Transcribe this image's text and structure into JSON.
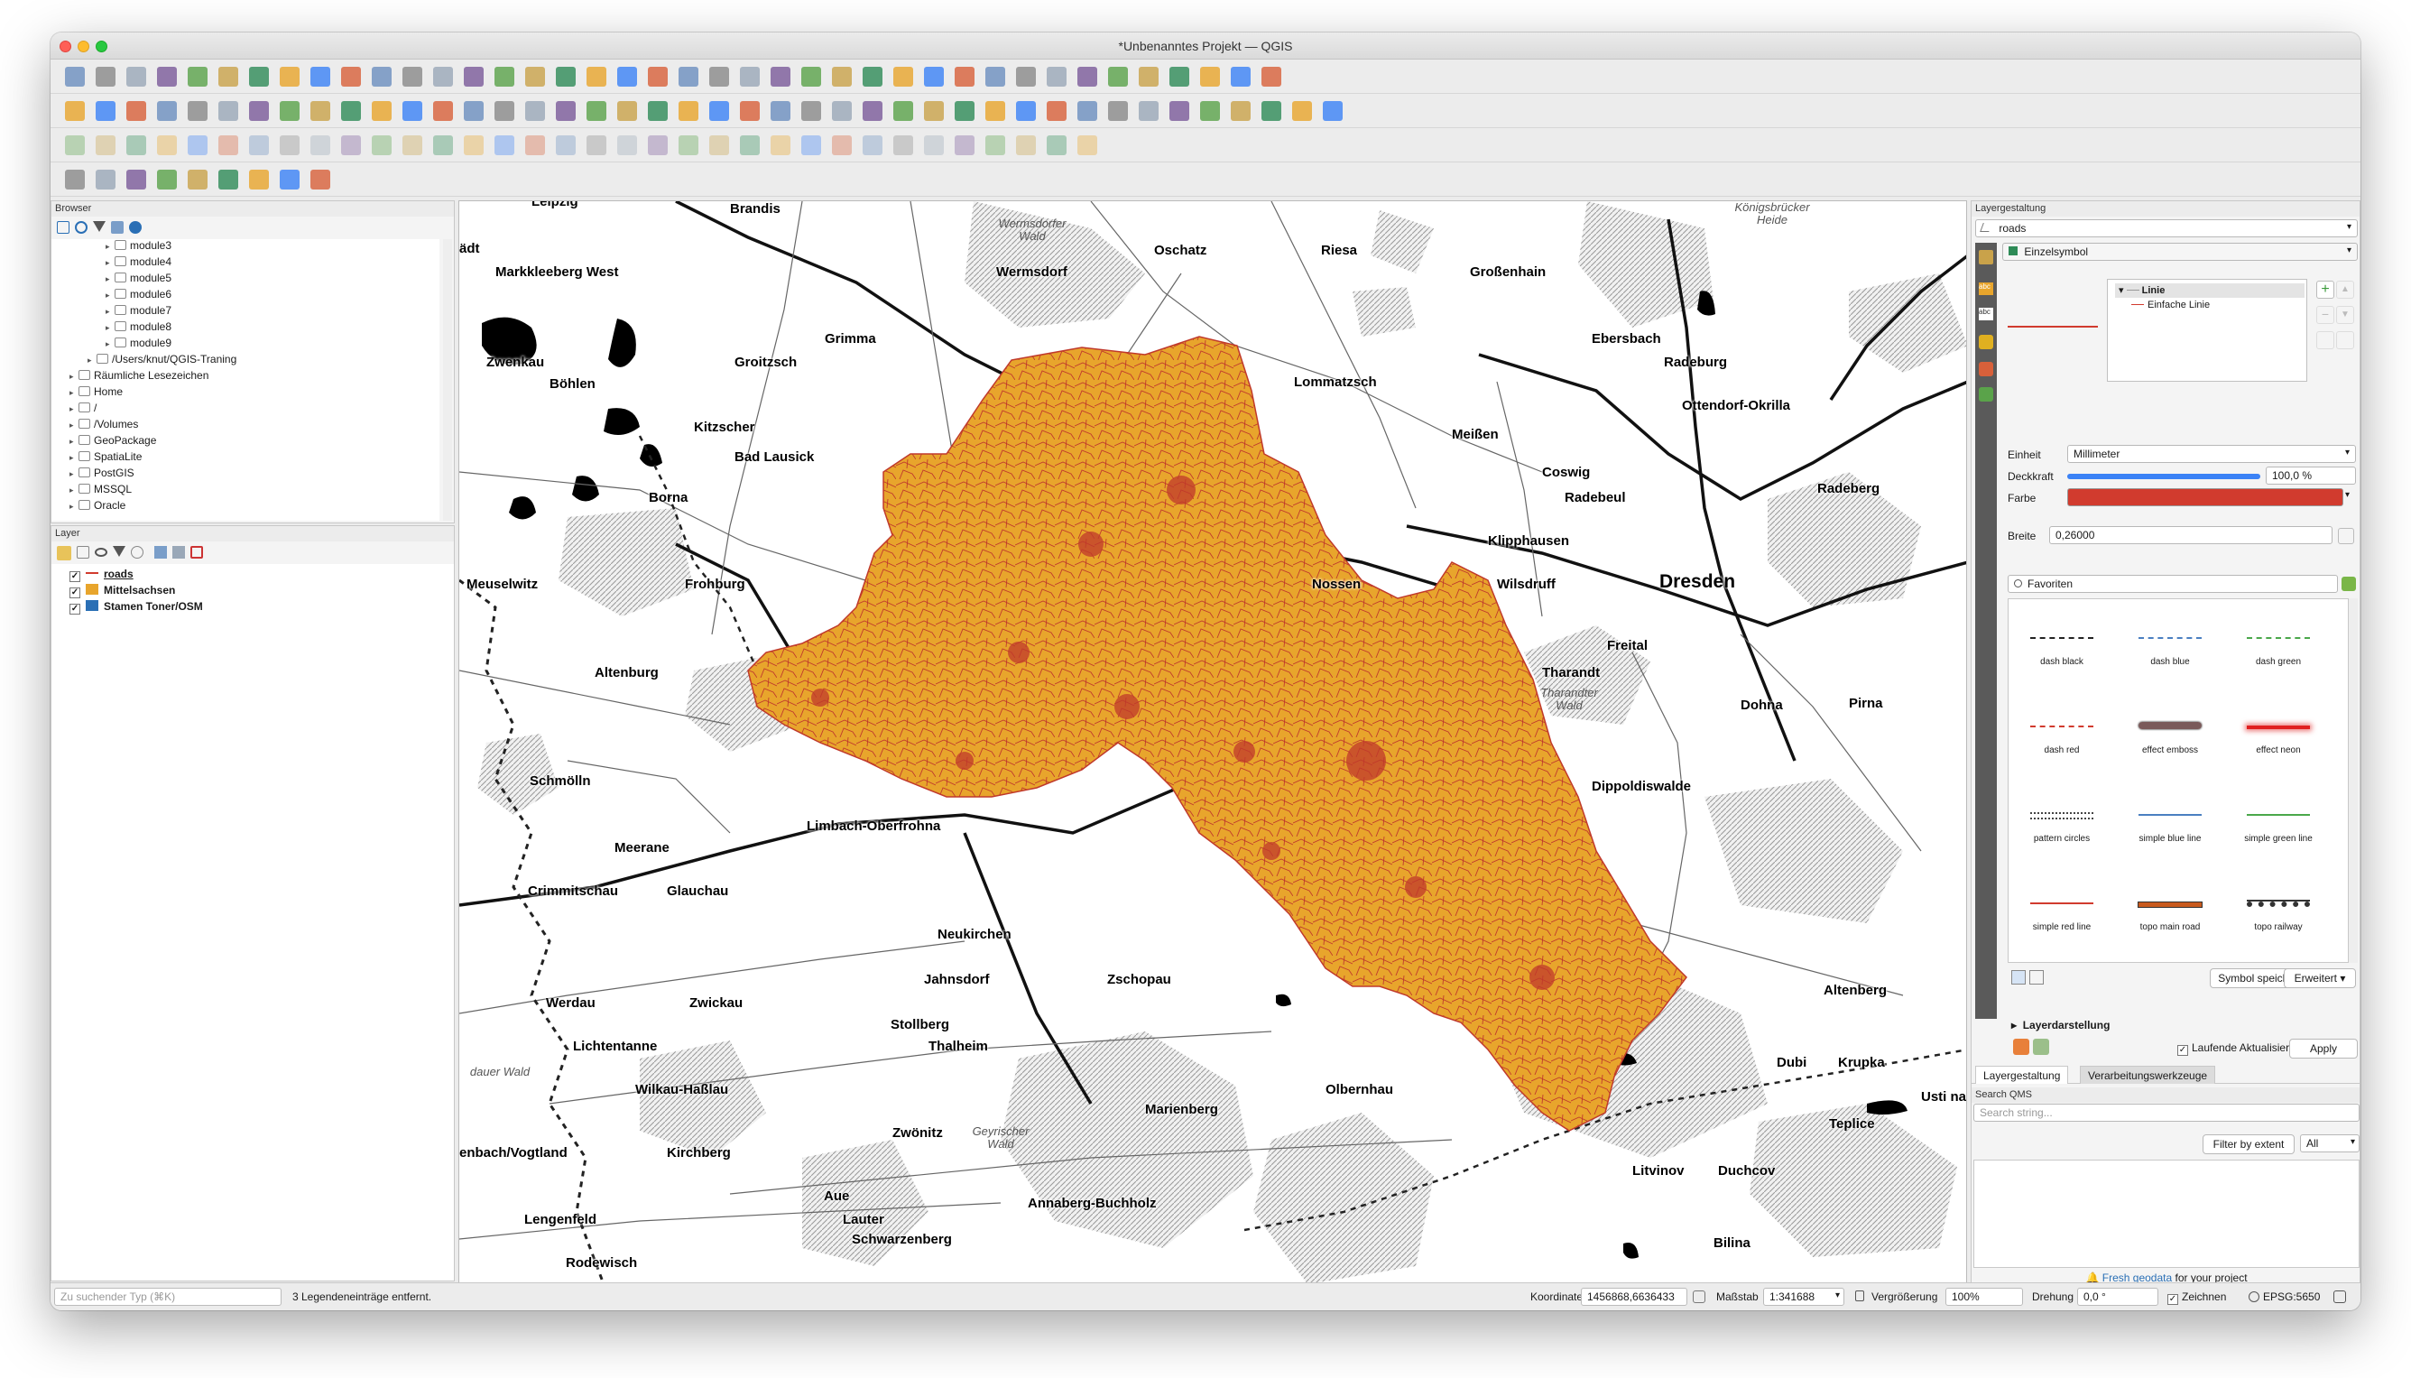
{
  "window": {
    "title": "*Unbenanntes Projekt — QGIS"
  },
  "browser": {
    "title": "Browser",
    "items": [
      {
        "label": "module3",
        "depth": 2
      },
      {
        "label": "module4",
        "depth": 2
      },
      {
        "label": "module5",
        "depth": 2
      },
      {
        "label": "module6",
        "depth": 2
      },
      {
        "label": "module7",
        "depth": 2
      },
      {
        "label": "module8",
        "depth": 2
      },
      {
        "label": "module9",
        "depth": 2
      },
      {
        "label": "/Users/knut/QGIS-Traning",
        "depth": 1
      },
      {
        "label": "Räumliche Lesezeichen",
        "depth": 0
      },
      {
        "label": "Home",
        "depth": 0
      },
      {
        "label": "/",
        "depth": 0
      },
      {
        "label": "/Volumes",
        "depth": 0
      },
      {
        "label": "GeoPackage",
        "depth": 0
      },
      {
        "label": "SpatiaLite",
        "depth": 0
      },
      {
        "label": "PostGIS",
        "depth": 0
      },
      {
        "label": "MSSQL",
        "depth": 0
      },
      {
        "label": "Oracle",
        "depth": 0
      }
    ]
  },
  "layers": {
    "title": "Layer",
    "items": [
      {
        "label": "roads",
        "checked": true,
        "swatch": "#d13b2e"
      },
      {
        "label": "Mittelsachsen",
        "checked": true,
        "swatch": "#e8a52c"
      },
      {
        "label": "Stamen Toner/OSM",
        "checked": true,
        "swatch": "#2a6fb5"
      }
    ]
  },
  "map": {
    "cities": [
      {
        "name": "Brandis"
      },
      {
        "name": "Oschatz"
      },
      {
        "name": "Riesa"
      },
      {
        "name": "Wermsdorf"
      },
      {
        "name": "Markkleeberg West"
      },
      {
        "name": "Großenhain"
      },
      {
        "name": "Grimma"
      },
      {
        "name": "Ebersbach"
      },
      {
        "name": "Zwenkau"
      },
      {
        "name": "Groitzsch"
      },
      {
        "name": "Radeburg"
      },
      {
        "name": "Lommatzsch"
      },
      {
        "name": "Böhlen"
      },
      {
        "name": "Ottendorf-Okrilla"
      },
      {
        "name": "Kitzscher"
      },
      {
        "name": "Meißen"
      },
      {
        "name": "Bad Lausick"
      },
      {
        "name": "Coswig"
      },
      {
        "name": "Borna"
      },
      {
        "name": "Radebeul"
      },
      {
        "name": "Radeberg"
      },
      {
        "name": "Klipphausen"
      },
      {
        "name": "Meuselwitz"
      },
      {
        "name": "Frohburg"
      },
      {
        "name": "Nossen"
      },
      {
        "name": "Wilsdruff"
      },
      {
        "name": "Dresden"
      },
      {
        "name": "Altenburg"
      },
      {
        "name": "Freital"
      },
      {
        "name": "Tharandt"
      },
      {
        "name": "Dohna"
      },
      {
        "name": "Pirna"
      },
      {
        "name": "Schmölln"
      },
      {
        "name": "Dippoldiswalde"
      },
      {
        "name": "Limbach-Oberfrohna"
      },
      {
        "name": "Meerane"
      },
      {
        "name": "Crimmitschau"
      },
      {
        "name": "Glauchau"
      },
      {
        "name": "Neukirchen"
      },
      {
        "name": "Jahnsdorf"
      },
      {
        "name": "Zschopau"
      },
      {
        "name": "Altenberg"
      },
      {
        "name": "Werdau"
      },
      {
        "name": "Zwickau"
      },
      {
        "name": "Stollberg"
      },
      {
        "name": "Lichtentanne"
      },
      {
        "name": "Thalheim"
      },
      {
        "name": "Dubi"
      },
      {
        "name": "Krupka"
      },
      {
        "name": "Wilkau-Haßlau"
      },
      {
        "name": "Olbernhau"
      },
      {
        "name": "Usti nad"
      },
      {
        "name": "Marienberg"
      },
      {
        "name": "Teplice"
      },
      {
        "name": "enbach/Vogtland"
      },
      {
        "name": "Kirchberg"
      },
      {
        "name": "Zwönitz"
      },
      {
        "name": "Litvinov"
      },
      {
        "name": "Duchcov"
      },
      {
        "name": "Aue"
      },
      {
        "name": "Annaberg-Buchholz"
      },
      {
        "name": "Lengenfeld"
      },
      {
        "name": "Lauter"
      },
      {
        "name": "Schwarzenberg"
      },
      {
        "name": "Bilina"
      },
      {
        "name": "Rodewisch"
      },
      {
        "name": "Leipzig"
      },
      {
        "name": "ädt"
      }
    ],
    "forests": [
      "Wermsdorfer Wald",
      "Königsbrücker Heide",
      "Tharandter Wald",
      "Geyrischer Wald",
      "dauer Wald"
    ]
  },
  "style_panel": {
    "title": "Layergestaltung",
    "layer_select": "roads",
    "renderer": "Einzelsymbol",
    "tree_root": "Linie",
    "tree_child": "Einfache Linie",
    "unit_label": "Einheit",
    "unit_value": "Millimeter",
    "opacity_label": "Deckkraft",
    "opacity_value": "100,0 %",
    "opacity_fraction": 1.0,
    "color_label": "Farbe",
    "color_value": "#d13b2e",
    "width_label": "Breite",
    "width_value": "0,26000",
    "favorites_placeholder": "Favoriten",
    "symbols": [
      {
        "name": "dash  black",
        "color": "#222222",
        "style": "dash"
      },
      {
        "name": "dash blue",
        "color": "#4a7fc1",
        "style": "dash"
      },
      {
        "name": "dash green",
        "color": "#4aa84a",
        "style": "dash"
      },
      {
        "name": "dash red",
        "color": "#d13b2e",
        "style": "dash"
      },
      {
        "name": "effect emboss",
        "color": "#7a5a5a",
        "style": "emboss"
      },
      {
        "name": "effect neon",
        "color": "#e02020",
        "style": "neon"
      },
      {
        "name": "pattern circles",
        "color": "#444444",
        "style": "circles"
      },
      {
        "name": "simple blue line",
        "color": "#4a7fc1",
        "style": "solid"
      },
      {
        "name": "simple green line",
        "color": "#4aa84a",
        "style": "solid"
      },
      {
        "name": "simple red line",
        "color": "#d13b2e",
        "style": "solid"
      },
      {
        "name": "topo main road",
        "color": "#c85a1e",
        "style": "topo"
      },
      {
        "name": "topo railway",
        "color": "#333333",
        "style": "rail"
      }
    ],
    "save_symbol": "Symbol speichern...",
    "advanced": "Erweitert",
    "layer_rendering": "Layerdarstellung",
    "live_update": "Laufende Aktualisierung",
    "apply": "Apply",
    "tab_style": "Layergestaltung",
    "tab_processing": "Verarbeitungswerkzeuge"
  },
  "qms": {
    "title": "Search QMS",
    "placeholder": "Search string...",
    "filter_btn": "Filter by extent",
    "filter_value": "All",
    "fresh_link": "Fresh geodata",
    "fresh_text": " for your project"
  },
  "status": {
    "search_placeholder": "Zu suchender Typ (⌘K)",
    "message": "3 Legendeneinträge entfernt.",
    "coord_label": "Koordinate",
    "coord_value": "1456868,6636433",
    "scale_label": "Maßstab",
    "scale_value": "1:341688",
    "magnify_label": "Vergrößerung",
    "magnify_value": "100%",
    "rotation_label": "Drehung",
    "rotation_value": "0,0 °",
    "render_label": "Zeichnen",
    "crs": "EPSG:5650"
  }
}
